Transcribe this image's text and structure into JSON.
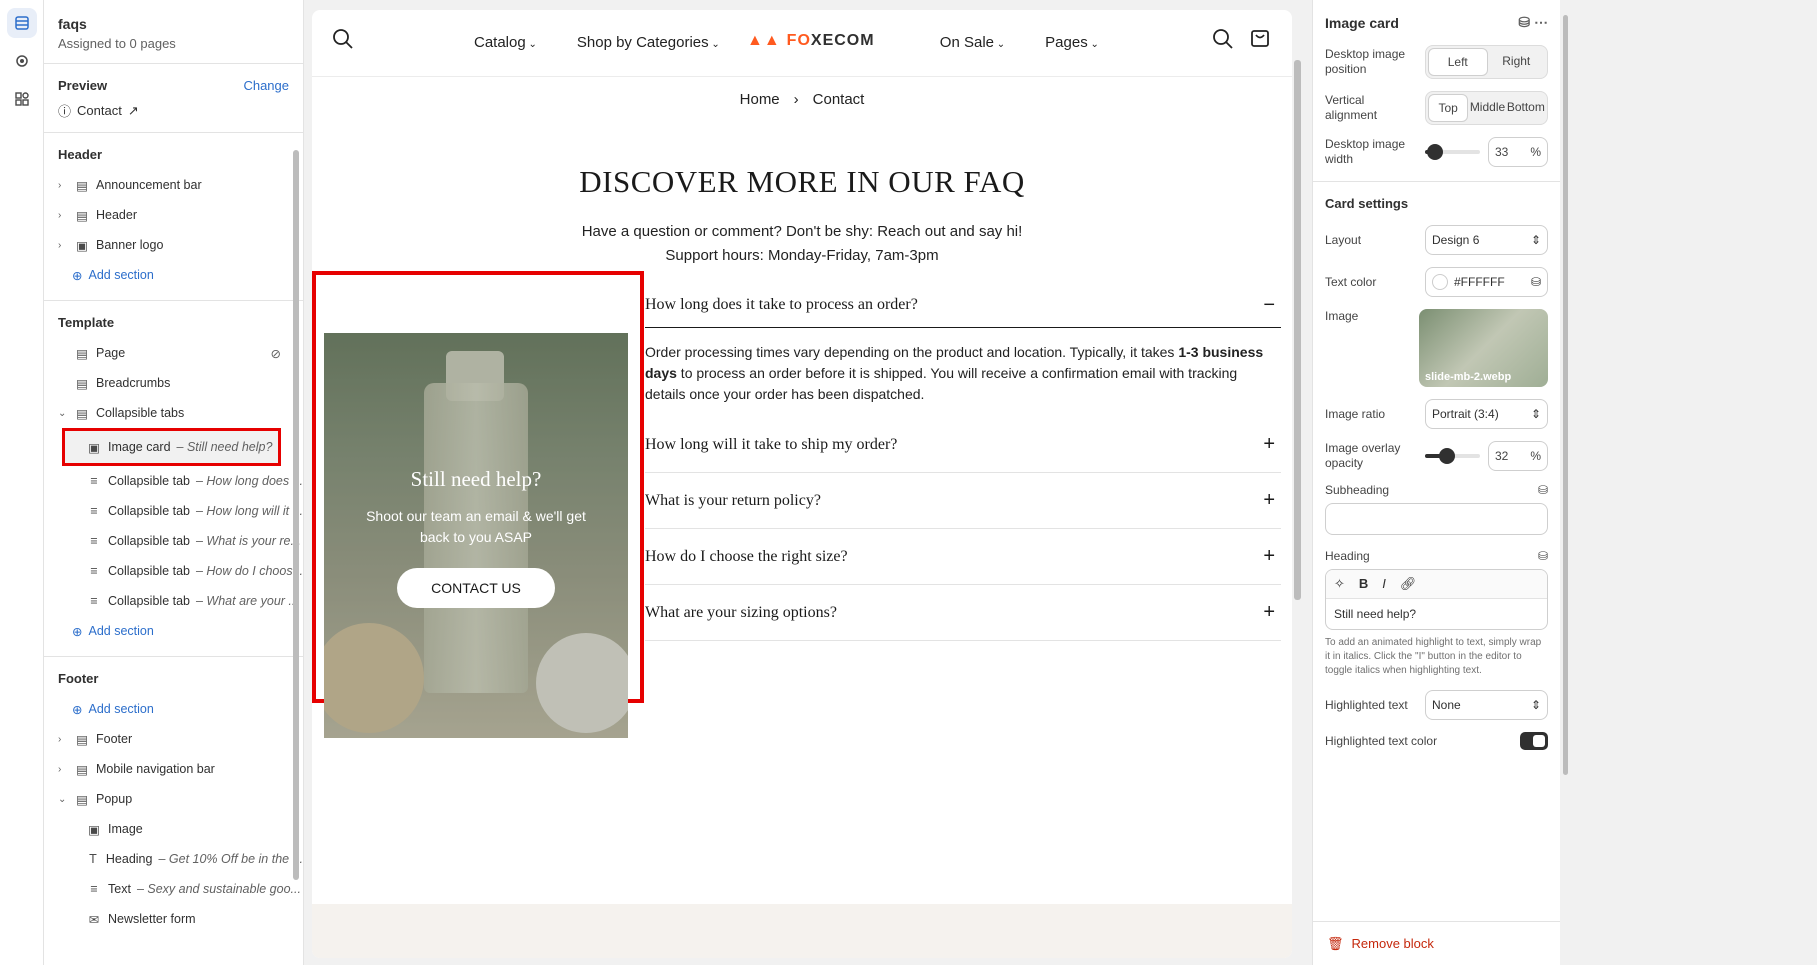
{
  "left": {
    "title": "faqs",
    "subtitle": "Assigned to 0 pages",
    "preview_label": "Preview",
    "change_label": "Change",
    "preview_page": "Contact",
    "header": {
      "title": "Header",
      "items": [
        "Announcement bar",
        "Header",
        "Banner logo"
      ],
      "add": "Add section"
    },
    "template": {
      "title": "Template",
      "items": [
        {
          "label": "Page",
          "note": ""
        },
        {
          "label": "Breadcrumbs",
          "note": ""
        },
        {
          "label": "Collapsible tabs",
          "note": ""
        }
      ],
      "blocks": [
        {
          "label": "Image card",
          "note": "– Still need help?"
        },
        {
          "label": "Collapsible tab",
          "note": "– How long does ..."
        },
        {
          "label": "Collapsible tab",
          "note": "– How long will it ..."
        },
        {
          "label": "Collapsible tab",
          "note": "– What is your re..."
        },
        {
          "label": "Collapsible tab",
          "note": "– How do I choos..."
        },
        {
          "label": "Collapsible tab",
          "note": "– What are your ..."
        }
      ],
      "add": "Add section"
    },
    "footer": {
      "title": "Footer",
      "add": "Add section",
      "items": [
        "Footer",
        "Mobile navigation bar",
        "Popup"
      ],
      "popup": [
        {
          "label": "Image",
          "note": ""
        },
        {
          "label": "Heading",
          "note": "– Get 10% Off be in the ..."
        },
        {
          "label": "Text",
          "note": "– Sexy and sustainable goo..."
        },
        {
          "label": "Newsletter form",
          "note": ""
        }
      ]
    }
  },
  "store": {
    "menu": [
      "Catalog",
      "Shop by Categories",
      "On Sale",
      "Pages"
    ],
    "logo": [
      "FO",
      "X",
      "ECOM"
    ],
    "breadcrumb": {
      "home": "Home",
      "sep": "›",
      "current": "Contact"
    },
    "heading": "DISCOVER MORE IN OUR FAQ",
    "sub1": "Have a question or comment? Don't be shy: Reach out and say hi!",
    "sub2": "Support hours: Monday-Friday, 7am-3pm",
    "card": {
      "heading": "Still need help?",
      "text": "Shoot our team an email & we'll get back to you ASAP",
      "button": "CONTACT US"
    },
    "faqs": {
      "open_q": "How long does it take to process an order?",
      "answer_a": "Order processing times vary depending on the product and location. Typically, it takes ",
      "answer_b": "1-3 business days",
      "answer_c": " to process an order before it is shipped. You will receive a confirmation email with tracking details once your order has been dispatched.",
      "q2": "How long will it take to ship my order?",
      "q3": "What is your return policy?",
      "q4": "How do I choose the right size?",
      "q5": "What are your sizing options?"
    }
  },
  "right": {
    "title": "Image card",
    "pos_label": "Desktop image position",
    "pos": [
      "Left",
      "Right"
    ],
    "valign_label": "Vertical alignment",
    "valign": [
      "Top",
      "Middle",
      "Bottom"
    ],
    "width_label": "Desktop image width",
    "width": "33",
    "pct": "%",
    "card_settings": "Card settings",
    "layout_label": "Layout",
    "layout": "Design 6",
    "textcolor_label": "Text color",
    "textcolor": "#FFFFFF",
    "image_label": "Image",
    "image_name": "slide-mb-2.webp",
    "ratio_label": "Image ratio",
    "ratio": "Portrait (3:4)",
    "overlay_label": "Image overlay opacity",
    "overlay": "32",
    "subheading_label": "Subheading",
    "heading_label": "Heading",
    "heading": "Still need help?",
    "help": "To add an animated highlight to text, simply wrap it in italics. Click the \"I\" button in the editor to toggle italics when highlighting text.",
    "highlight_label": "Highlighted text",
    "highlight": "None",
    "hcolor_label": "Highlighted text color",
    "remove": "Remove block"
  }
}
